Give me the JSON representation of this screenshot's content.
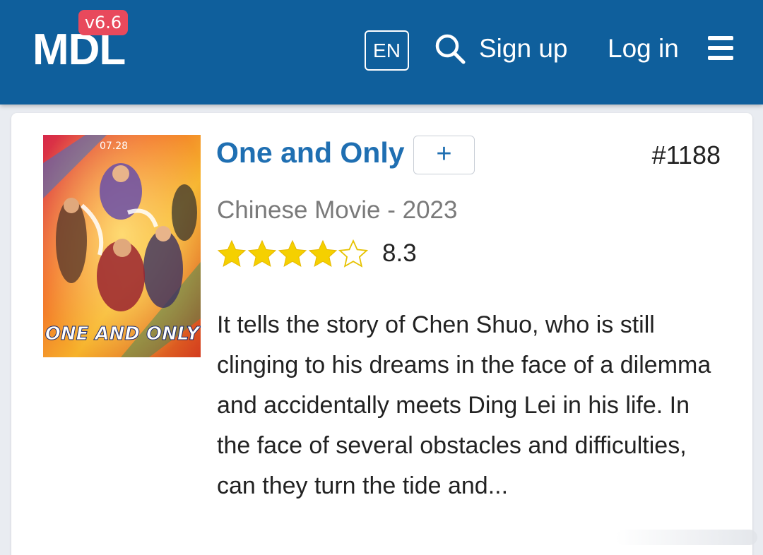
{
  "header": {
    "logo": "MDL",
    "version": "v6.6",
    "language": "EN",
    "search_icon": "search-icon",
    "signup": "Sign up",
    "login": "Log in",
    "menu_icon": "hamburger-menu-icon",
    "background_color": "#0f5f9c"
  },
  "item": {
    "title": "One and Only",
    "add_label": "+",
    "rank": "#1188",
    "meta": "Chinese Movie - 2023",
    "rating": "8.3",
    "stars_filled": 4,
    "stars_total": 5,
    "description": "It tells the story of Chen Shuo, who is still clinging to his dreams in the face of a dilemma and accidentally meets Ding Lei in his life. In the face of several obstacles and difficulties, can they turn the tide and...",
    "title_color": "#1f6fb2",
    "star_color": "#f5d000"
  }
}
